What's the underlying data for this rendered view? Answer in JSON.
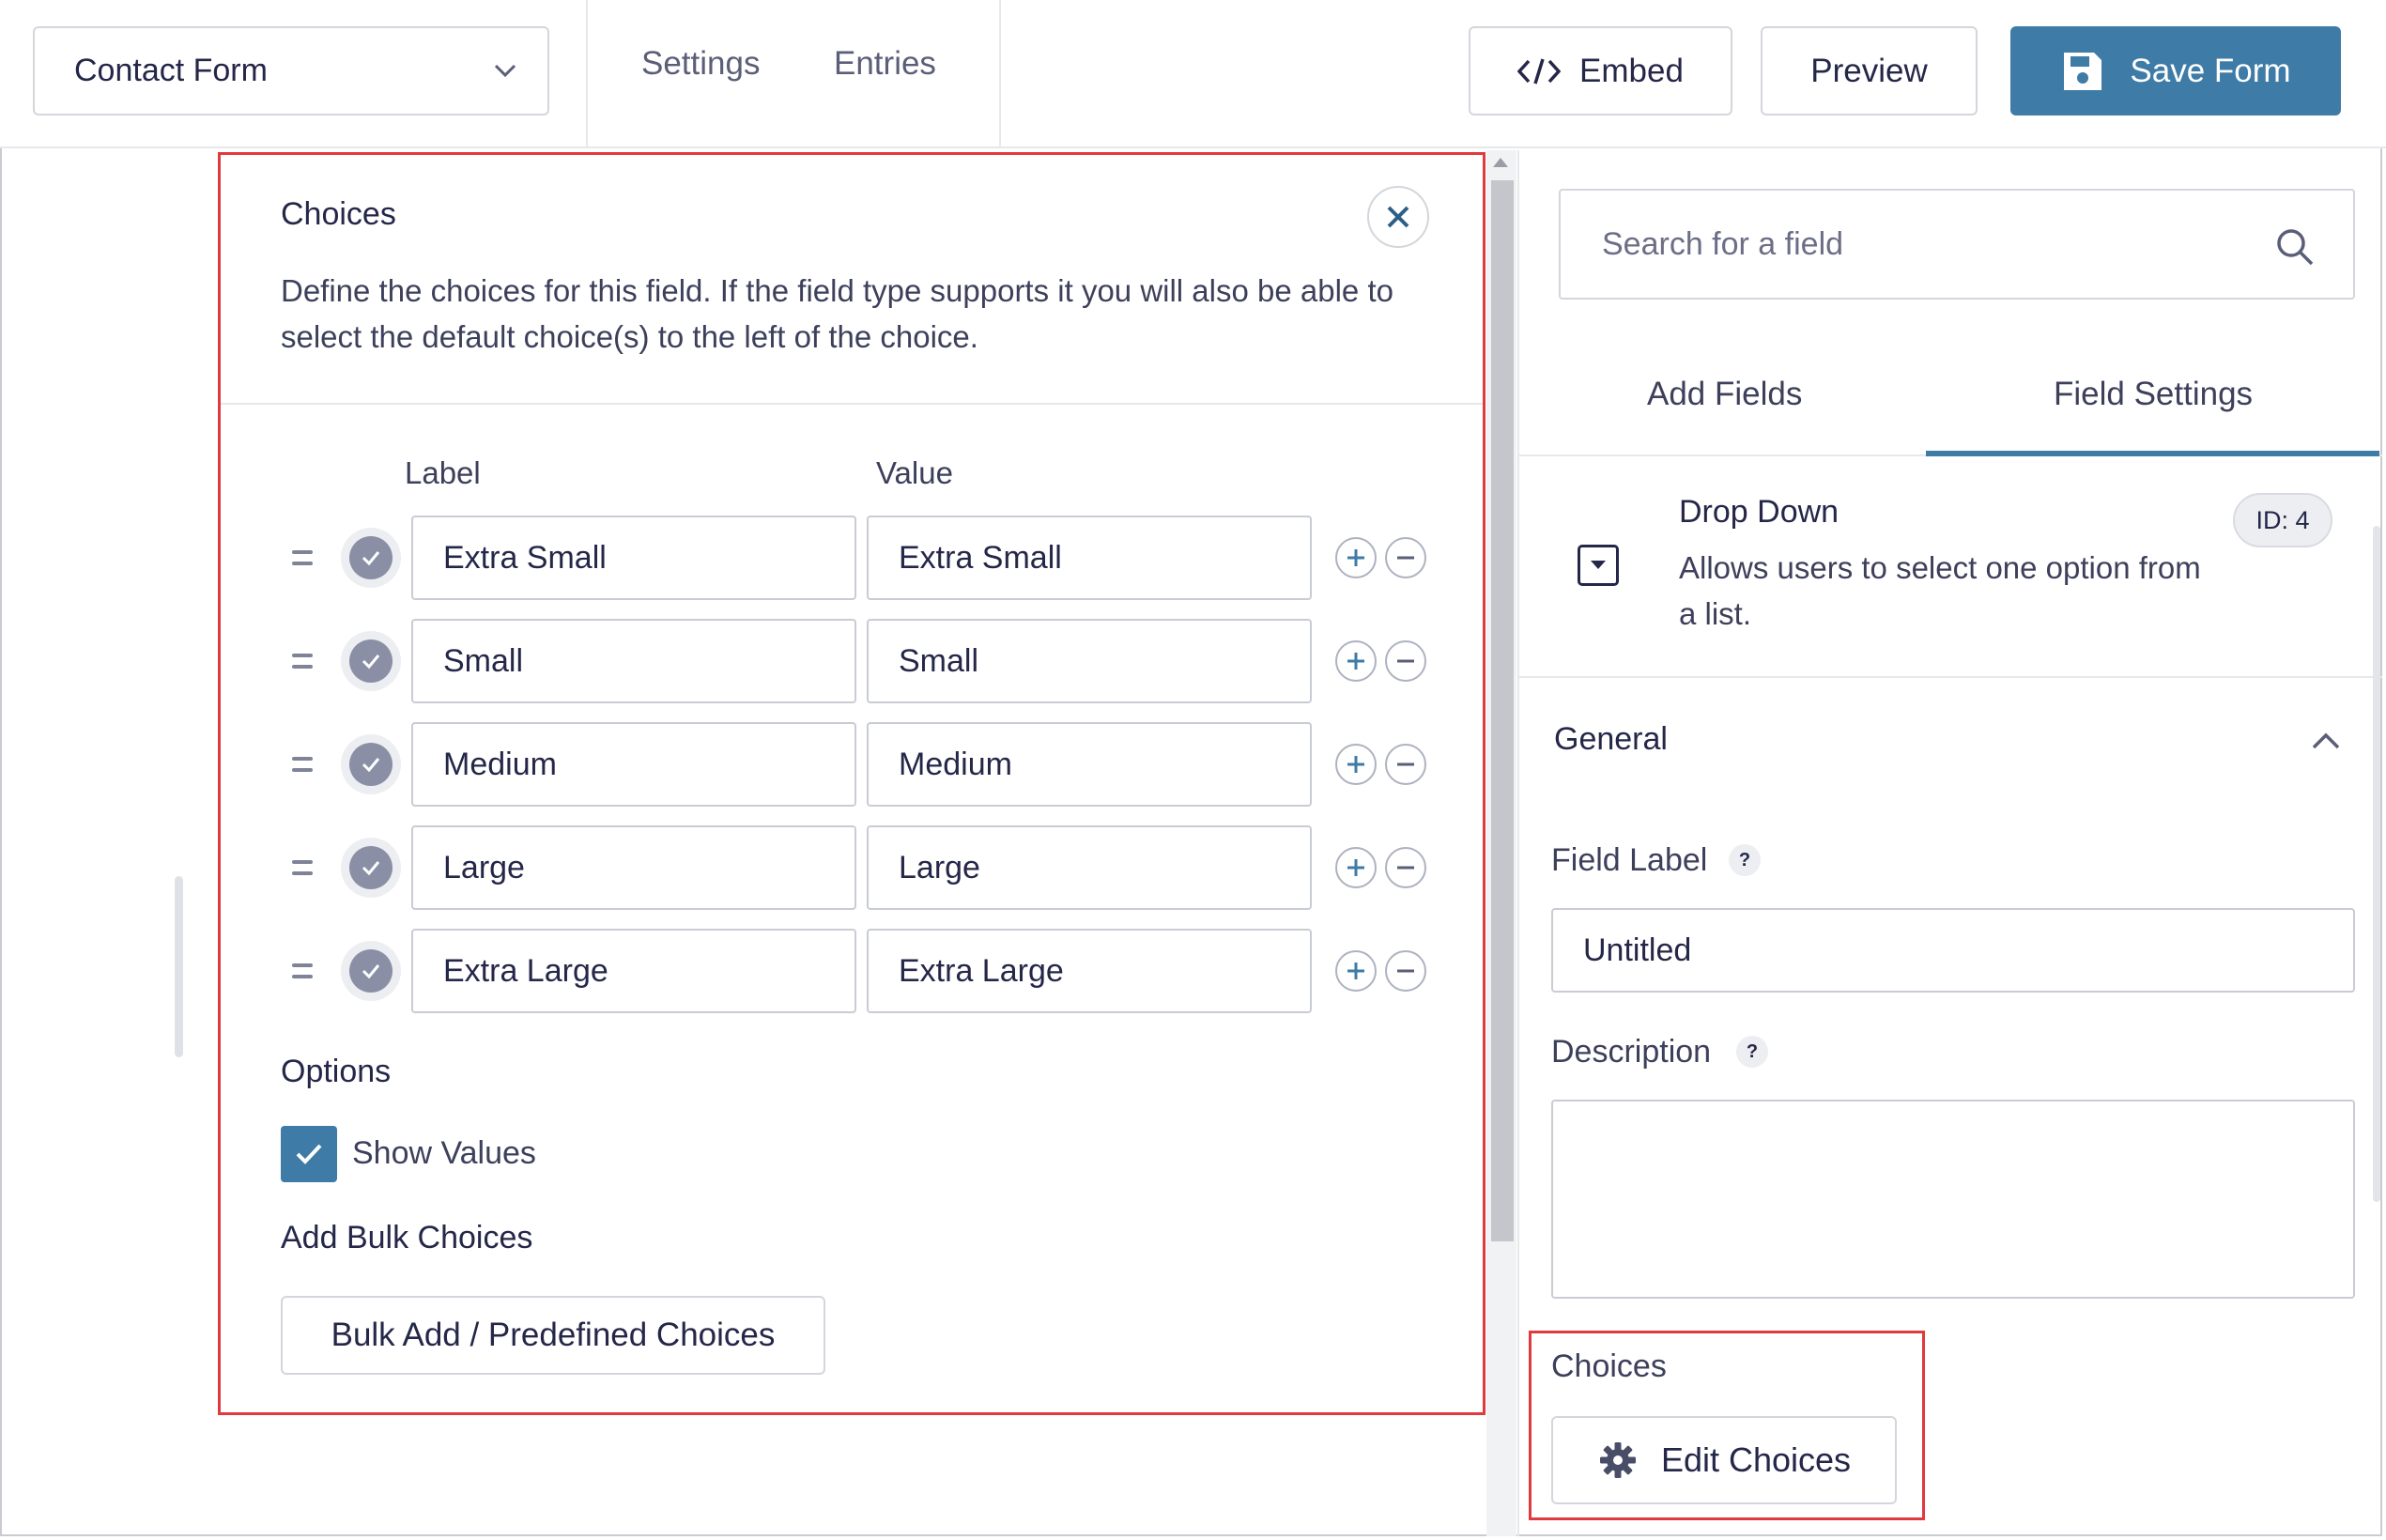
{
  "header": {
    "form_selector": "Contact Form",
    "nav": [
      "Settings",
      "Entries"
    ],
    "embed_label": "Embed",
    "preview_label": "Preview",
    "save_label": "Save Form"
  },
  "modal": {
    "title": "Choices",
    "description": "Define the choices for this field. If the field type supports it you will also be able to select the default choice(s) to the left of the choice.",
    "label_header": "Label",
    "value_header": "Value",
    "choices": [
      {
        "label": "Extra Small",
        "value": "Extra Small"
      },
      {
        "label": "Small",
        "value": "Small"
      },
      {
        "label": "Medium",
        "value": "Medium"
      },
      {
        "label": "Large",
        "value": "Large"
      },
      {
        "label": "Extra Large",
        "value": "Extra Large"
      }
    ],
    "options_title": "Options",
    "show_values_label": "Show Values",
    "show_values_checked": true,
    "bulk_title": "Add Bulk Choices",
    "bulk_button": "Bulk Add / Predefined Choices"
  },
  "sidebar": {
    "search_placeholder": "Search for a field",
    "tabs": [
      "Add Fields",
      "Field Settings"
    ],
    "active_tab": "Field Settings",
    "field": {
      "name": "Drop Down",
      "description": "Allows users to select one option from a list.",
      "id_badge": "ID: 4"
    },
    "general_title": "General",
    "field_label_title": "Field Label",
    "field_label_value": "Untitled",
    "description_title": "Description",
    "description_value": "",
    "help_mark": "?",
    "choices_title": "Choices",
    "edit_choices_label": "Edit Choices"
  },
  "colors": {
    "accent": "#3e7ba6",
    "highlight": "#e0393e",
    "text": "#242748"
  },
  "icons": [
    "chevron-down-icon",
    "code-icon",
    "save-disk-icon",
    "close-icon",
    "drag-handle-icon",
    "check-icon",
    "plus-icon",
    "minus-icon",
    "search-icon",
    "dropdown-field-icon",
    "chevron-up-icon",
    "help-icon",
    "gear-icon"
  ]
}
